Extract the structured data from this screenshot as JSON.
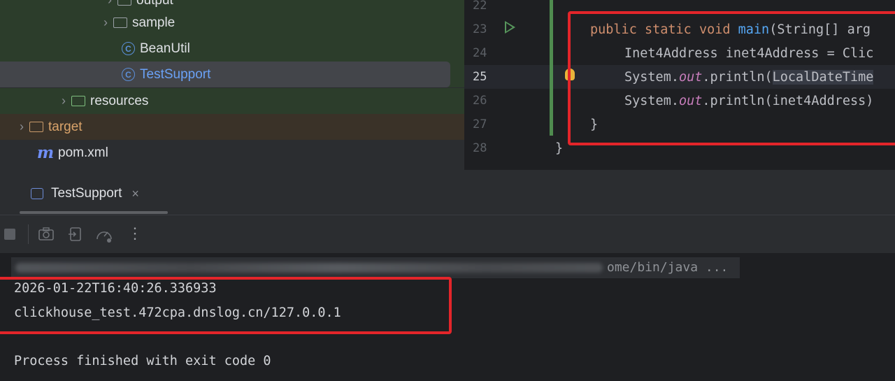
{
  "project_tree": {
    "items": [
      {
        "label": "output",
        "kind": "folder"
      },
      {
        "label": "sample",
        "kind": "folder"
      },
      {
        "label": "BeanUtil",
        "kind": "class"
      },
      {
        "label": "TestSupport",
        "kind": "class"
      },
      {
        "label": "resources",
        "kind": "resources-folder"
      },
      {
        "label": "target",
        "kind": "folder"
      },
      {
        "label": "pom.xml",
        "kind": "maven-file"
      }
    ]
  },
  "editor": {
    "line_numbers": [
      "22",
      "23",
      "24",
      "25",
      "26",
      "27",
      "28"
    ],
    "current_line": "25",
    "lines": {
      "l23_public": "public",
      "l23_static": "static",
      "l23_void": "void",
      "l23_main": "main",
      "l23_rest": "(String[] arg",
      "l24": "Inet4Address inet4Address = Clic",
      "l25_sys": "System.",
      "l25_out": "out",
      "l25_println": ".println(",
      "l25_hl": "LocalDateTime",
      "l26_sys": "System.",
      "l26_out": "out",
      "l26_rest": ".println(inet4Address)",
      "l27": "}",
      "l28": "}"
    }
  },
  "run_panel": {
    "tab_label": "TestSupport",
    "tab_close": "×",
    "toolbar_more": "⋮",
    "console": {
      "command_tail": "ome/bin/java ...",
      "timestamp_output": "2026-01-22T16:40:26.336933",
      "address_output": "clickhouse_test.472cpa.dnslog.cn/127.0.0.1",
      "exit_message": "Process finished with exit code 0"
    }
  },
  "colors": {
    "highlight_box": "#e3252a",
    "keyword": "#cf8e6d",
    "function": "#56a8f5",
    "static_field": "#c77dbb"
  }
}
